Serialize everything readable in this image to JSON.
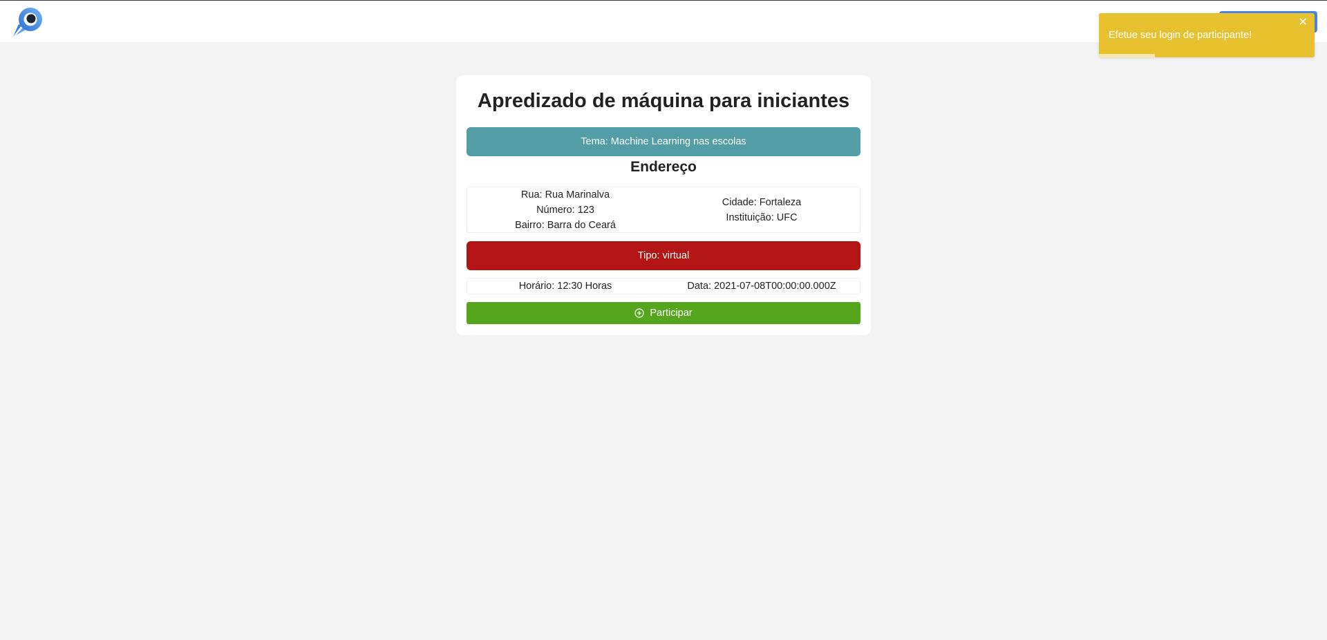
{
  "header": {
    "logo_icon": "rocket-logo-icon"
  },
  "event": {
    "title": "Apredizado de máquina para iniciantes",
    "tema": "Tema: Machine Learning nas escolas",
    "address_heading": "Endereço",
    "rua": "Rua: Rua Marinalva",
    "numero": "Número: 123",
    "bairro": "Bairro: Barra do Ceará",
    "cidade": "Cidade: Fortaleza",
    "instituicao": "Instituição: UFC",
    "tipo": "Tipo: virtual",
    "horario": "Horário: 12:30 Horas",
    "data": "Data: 2021-07-08T00:00:00.000Z",
    "participate_label": "Participar",
    "participate_icon": "plus-circle-icon"
  },
  "toast": {
    "message": "Efetue seu login de participante!",
    "close": "✕",
    "progress": 0.26
  },
  "colors": {
    "tema_bg": "#539ea6",
    "tipo_bg": "#b31515",
    "participate_bg": "#56a61d",
    "toast_bg": "#e8c22e",
    "nav_button": "#4a86e8"
  }
}
